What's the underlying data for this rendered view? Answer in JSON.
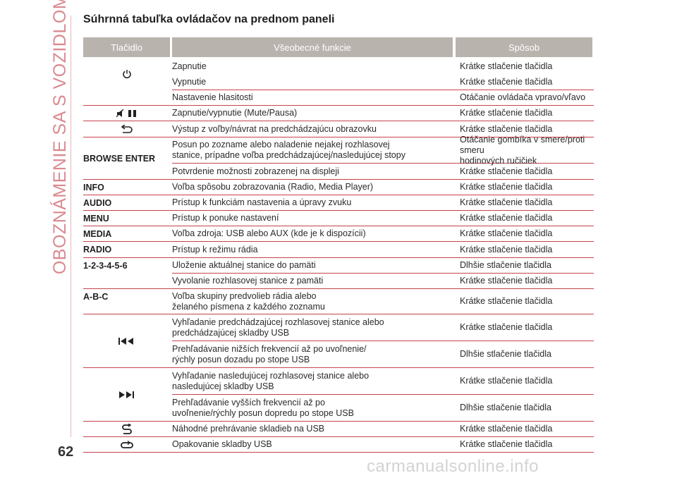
{
  "side_title": "OBOZNÁMENIE SA S VOZIDLOM",
  "page_number": "62",
  "title": "Súhrnná tabuľka ovládačov na prednom paneli",
  "headers": [
    "Tlačidlo",
    "Všeobecné funkcie",
    "Spôsob"
  ],
  "rows": [
    {
      "key": "",
      "icon": "power-icon",
      "func": "Zapnutie",
      "method": "Krátke stlačenie tlačidla"
    },
    {
      "key": "",
      "icon": "",
      "func": "Vypnutie",
      "method": "Krátke stlačenie tlačidla"
    },
    {
      "key": "",
      "icon": "",
      "func": "Nastavenie hlasitosti",
      "method": "Otáčanie ovládača vpravo/vľavo"
    },
    {
      "key": "",
      "icon": "mute-pause-icon",
      "func": "Zapnutie/vypnutie (Mute/Pausa)",
      "method": "Krátke stlačenie tlačidla"
    },
    {
      "key": "",
      "icon": "back-arrow-icon",
      "func": "Výstup z voľby/návrat na predchádzajúcu obrazovku",
      "method": "Krátke stlačenie tlačidla"
    },
    {
      "key": "BROWSE ENTER",
      "icon": "",
      "func": "Posun po zozname alebo naladenie nejakej rozhlasovej\nstanice, prípadne voľba predchádzajúcej/nasledujúcej stopy",
      "method": "Otáčanie gombíka v smere/proti smeru\nhodinových ručičiek"
    },
    {
      "key": "",
      "icon": "",
      "func": "Potvrdenie možnosti zobrazenej na displeji",
      "method": "Krátke stlačenie tlačidla"
    },
    {
      "key": "INFO",
      "icon": "",
      "func": "Voľba spôsobu zobrazovania (Radio, Media Player)",
      "method": "Krátke stlačenie tlačidla"
    },
    {
      "key": "AUDIO",
      "icon": "",
      "func": "Prístup k funkciám nastavenia a úpravy zvuku",
      "method": "Krátke stlačenie tlačidla"
    },
    {
      "key": "MENU",
      "icon": "",
      "func": "Prístup k ponuke nastavení",
      "method": "Krátke stlačenie tlačidla"
    },
    {
      "key": "MEDIA",
      "icon": "",
      "func": "Voľba zdroja: USB alebo AUX (kde je k dispozícii)",
      "method": "Krátke stlačenie tlačidla"
    },
    {
      "key": "RADIO",
      "icon": "",
      "func": "Prístup k režimu rádia",
      "method": "Krátke stlačenie tlačidla"
    },
    {
      "key": "1-2-3-4-5-6",
      "icon": "",
      "func": "Uloženie aktuálnej stanice do pamäti",
      "method": "Dlhšie stlačenie tlačidla"
    },
    {
      "key": "",
      "icon": "",
      "func": "Vyvolanie rozhlasovej stanice z pamäti",
      "method": "Krátke stlačenie tlačidla"
    },
    {
      "key": "A-B-C",
      "icon": "",
      "func": "Voľba skupiny predvolieb rádia alebo\nželaného písmena z každého zoznamu",
      "method": "Krátke stlačenie tlačidla"
    },
    {
      "key": "",
      "icon": "previous-track-icon",
      "func": "Vyhľadanie predchádzajúcej rozhlasovej stanice alebo\npredchádzajúcej skladby USB",
      "method": "Krátke stlačenie tlačidla"
    },
    {
      "key": "",
      "icon": "",
      "func": "Prehľadávanie nižších frekvencií až po uvoľnenie/\nrýchly posun dozadu po stope USB",
      "method": "Dlhšie stlačenie tlačidla"
    },
    {
      "key": "",
      "icon": "next-track-icon",
      "func": "Vyhľadanie nasledujúcej rozhlasovej stanice alebo\nnasledujúcej skladby USB",
      "method": "Krátke stlačenie tlačidla"
    },
    {
      "key": "",
      "icon": "",
      "func": "Prehľadávanie vyšších frekvencií až po\nuvoľnenie/rýchly posun dopredu po stope USB",
      "method": "Dlhšie stlačenie tlačidla"
    },
    {
      "key": "",
      "icon": "shuffle-icon",
      "func": "Náhodné prehrávanie skladieb na USB",
      "method": "Krátke stlačenie tlačidla"
    },
    {
      "key": "",
      "icon": "repeat-icon",
      "func": "Opakovanie skladby USB",
      "method": "Krátke stlačenie tlačidla"
    }
  ],
  "footer_watermark": "carmanualsonline.info",
  "colors": {
    "accent_line": "#c7434b",
    "header_bg": "#b9b3ae",
    "side_title": "#d98a8f"
  }
}
